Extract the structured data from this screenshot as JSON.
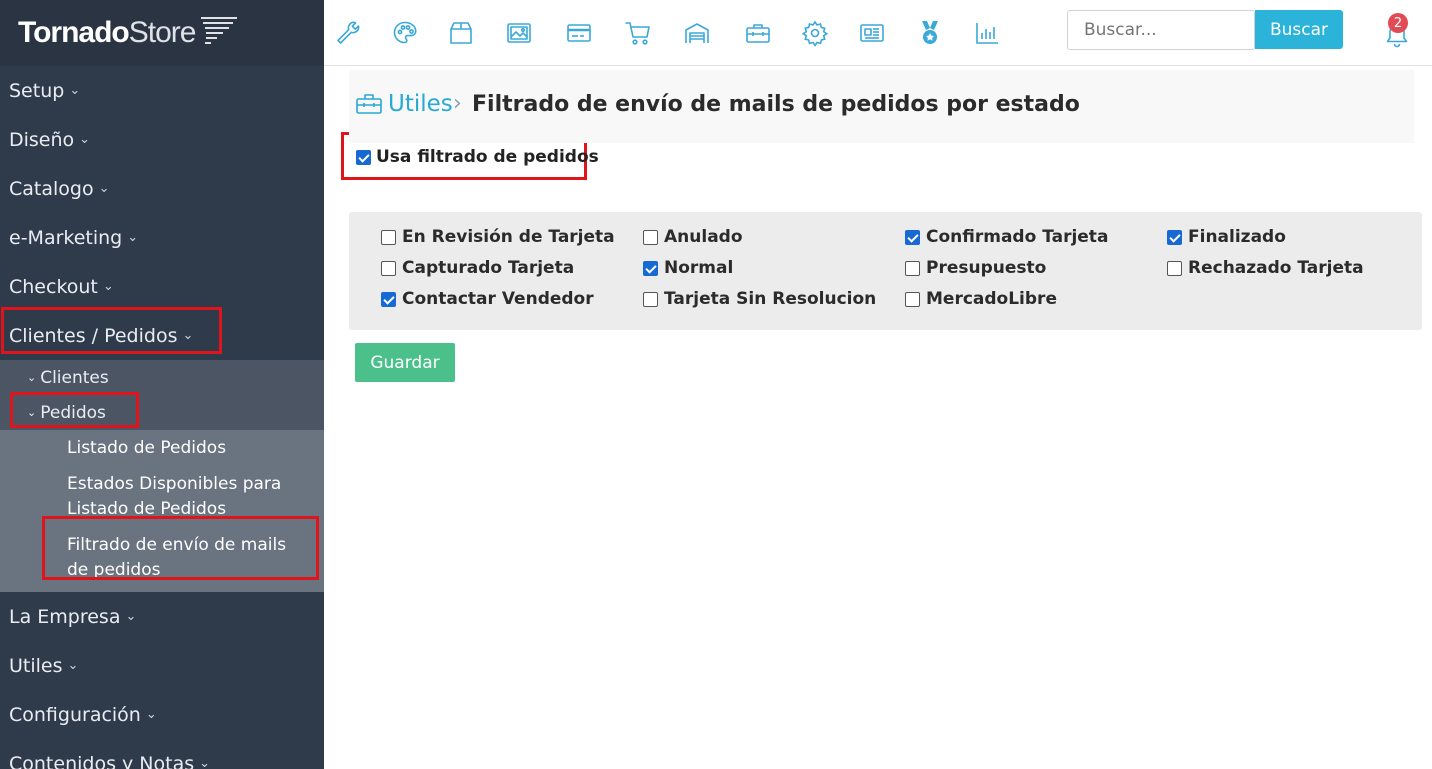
{
  "brand": {
    "name_part1": "Tornado",
    "name_part2": "Store"
  },
  "sidebar": {
    "items": [
      {
        "label": "Setup"
      },
      {
        "label": "Diseño"
      },
      {
        "label": "Catalogo"
      },
      {
        "label": "e-Marketing"
      },
      {
        "label": "Checkout"
      },
      {
        "label": "Clientes / Pedidos"
      }
    ],
    "sub": [
      {
        "label": "Clientes"
      },
      {
        "label": "Pedidos"
      }
    ],
    "pedidos_children": [
      {
        "label": "Listado de Pedidos"
      },
      {
        "label": "Estados Disponibles para Listado de Pedidos"
      },
      {
        "label": "Filtrado de envío de mails de pedidos"
      }
    ],
    "bottom_items": [
      {
        "label": "La Empresa"
      },
      {
        "label": "Utiles"
      },
      {
        "label": "Configuración"
      },
      {
        "label": "Contenidos y Notas"
      }
    ],
    "chevron": "⌄"
  },
  "topbar": {
    "icons": [
      "wrench-icon",
      "palette-icon",
      "box-icon",
      "image-icon",
      "credit-card-icon",
      "cart-icon",
      "warehouse-icon",
      "toolbox-icon",
      "gear-icon",
      "newspaper-icon",
      "medal-icon",
      "bar-chart-icon"
    ],
    "search": {
      "placeholder": "Buscar...",
      "button_label": "Buscar"
    },
    "notifications": {
      "count": "2"
    }
  },
  "breadcrumb": {
    "parent": "Utiles",
    "separator": "›",
    "title": "Filtrado de envío de mails de pedidos por estado"
  },
  "use_filter": {
    "label": "Usa filtrado de pedidos",
    "checked": true
  },
  "states": [
    {
      "label": "En Revisión de Tarjeta",
      "checked": false
    },
    {
      "label": "Anulado",
      "checked": false
    },
    {
      "label": "Confirmado Tarjeta",
      "checked": true
    },
    {
      "label": "Finalizado",
      "checked": true
    },
    {
      "label": "Capturado Tarjeta",
      "checked": false
    },
    {
      "label": "Normal",
      "checked": true
    },
    {
      "label": "Presupuesto",
      "checked": false
    },
    {
      "label": "Rechazado Tarjeta",
      "checked": false
    },
    {
      "label": "Contactar Vendedor",
      "checked": true
    },
    {
      "label": "Tarjeta Sin Resolucion",
      "checked": false
    },
    {
      "label": "MercadoLibre",
      "checked": false
    }
  ],
  "save_button": {
    "label": "Guardar"
  },
  "colors": {
    "sidebar_bg": "#2f3a4a",
    "accent": "#2bb3d9",
    "save": "#4cc08a",
    "highlight": "#e0151b",
    "checkbox": "#1769d3"
  }
}
